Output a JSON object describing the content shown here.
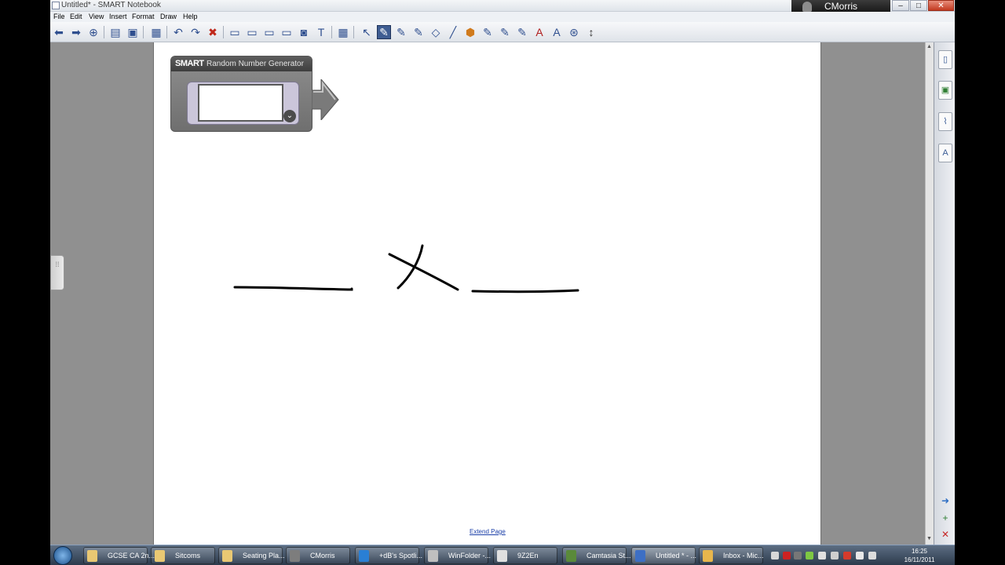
{
  "window": {
    "title": "Untitled* - SMART Notebook",
    "user": "CMorris",
    "controls": {
      "minimize": "–",
      "maximize": "□",
      "close": "✕"
    }
  },
  "menu": [
    "File",
    "Edit",
    "View",
    "Insert",
    "Format",
    "Draw",
    "Help"
  ],
  "toolbar": [
    {
      "name": "previous-page",
      "glyph": "⬅"
    },
    {
      "name": "next-page",
      "glyph": "➡"
    },
    {
      "name": "add-page",
      "glyph": "⊕"
    },
    {
      "name": "open-file",
      "glyph": "▤"
    },
    {
      "name": "save",
      "glyph": "▣"
    },
    {
      "name": "paste",
      "glyph": "▦"
    },
    {
      "name": "undo",
      "glyph": "↶"
    },
    {
      "name": "redo",
      "glyph": "↷"
    },
    {
      "name": "delete",
      "glyph": "✖"
    },
    {
      "name": "show-hide-screen-shade",
      "glyph": "▭"
    },
    {
      "name": "full-screen",
      "glyph": "▭"
    },
    {
      "name": "transparent-background",
      "glyph": "▭"
    },
    {
      "name": "dual-page-display",
      "glyph": "▭"
    },
    {
      "name": "screen-capture",
      "glyph": "◙"
    },
    {
      "name": "document-camera",
      "glyph": "T"
    },
    {
      "name": "insert-table",
      "glyph": "▦"
    },
    {
      "name": "select",
      "glyph": "↖"
    },
    {
      "name": "pen",
      "glyph": "✎"
    },
    {
      "name": "creative-pen",
      "glyph": "✎"
    },
    {
      "name": "highlighter",
      "glyph": "✎"
    },
    {
      "name": "eraser",
      "glyph": "◇"
    },
    {
      "name": "line",
      "glyph": "╱"
    },
    {
      "name": "shapes",
      "glyph": "⬢"
    },
    {
      "name": "magic-pen",
      "glyph": "✎"
    },
    {
      "name": "fill",
      "glyph": "✎"
    },
    {
      "name": "shape-recognition-pen",
      "glyph": "✎"
    },
    {
      "name": "text",
      "glyph": "A"
    },
    {
      "name": "properties",
      "glyph": "A"
    },
    {
      "name": "zoom",
      "glyph": "⊛"
    },
    {
      "name": "move-toolbar",
      "glyph": "↕"
    }
  ],
  "widget": {
    "brand": "SMART",
    "title": "Random Number Generator",
    "display_value": "",
    "expand_glyph": "⌄"
  },
  "page": {
    "extend_label": "Extend Page"
  },
  "side_tabs": [
    {
      "name": "page-sorter",
      "glyph": "▯"
    },
    {
      "name": "gallery",
      "glyph": "▣"
    },
    {
      "name": "attachments",
      "glyph": "⌇"
    },
    {
      "name": "properties",
      "glyph": "A"
    }
  ],
  "side_bottom": [
    {
      "name": "auto-hide",
      "glyph": "➜"
    },
    {
      "name": "add",
      "glyph": "+"
    },
    {
      "name": "close",
      "glyph": "✕"
    }
  ],
  "taskbar": {
    "tasks": [
      {
        "label": "GCSE CA 2n...",
        "icon_color": "#e9c873"
      },
      {
        "label": "Sitcoms",
        "icon_color": "#e9c873"
      },
      {
        "label": "Seating Pla...",
        "icon_color": "#e9c873"
      },
      {
        "label": "CMorris",
        "icon_color": "#7d7d7d"
      },
      {
        "label": "+dB's Spotli...",
        "icon_color": "#2a7fd4"
      },
      {
        "label": "WinFolder -...",
        "icon_color": "#bfbfbf"
      },
      {
        "label": "9Z2En",
        "icon_color": "#e0e0e0"
      },
      {
        "label": "Camtasia St...",
        "icon_color": "#5a8a3a"
      },
      {
        "label": "Untitled * - ...",
        "icon_color": "#3d6fc4"
      },
      {
        "label": "Inbox - Mic...",
        "icon_color": "#e8b64c"
      }
    ],
    "clock_time": "16:25",
    "clock_date": "16/11/2011"
  }
}
